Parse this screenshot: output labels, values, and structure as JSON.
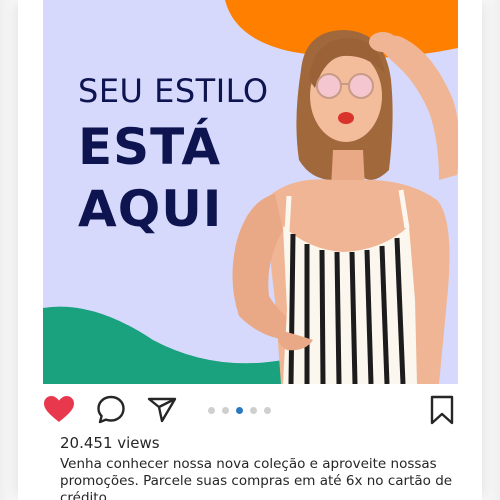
{
  "post": {
    "headline": {
      "line1": "SEU ESTILO",
      "line2": "ESTÁ",
      "line3": "AQUI"
    },
    "views": "20.451 views",
    "caption": "Venha conhecer nossa nova coleção e aproveite nossas promoções. Parcele suas compras em até 6x no cartão de crédito."
  },
  "actions": {
    "icons": [
      "heart-icon",
      "comment-icon",
      "share-icon",
      "bookmark-icon"
    ],
    "carousel_dot_count": 5,
    "carousel_active_index": 2
  },
  "colors": {
    "headline": "#0d1450",
    "background": "#d6d9fb",
    "orange_shape": "#ff7f00",
    "green_shape": "#1aa17d",
    "like_red": "#e8384e",
    "active_dot": "#2a78c2"
  }
}
